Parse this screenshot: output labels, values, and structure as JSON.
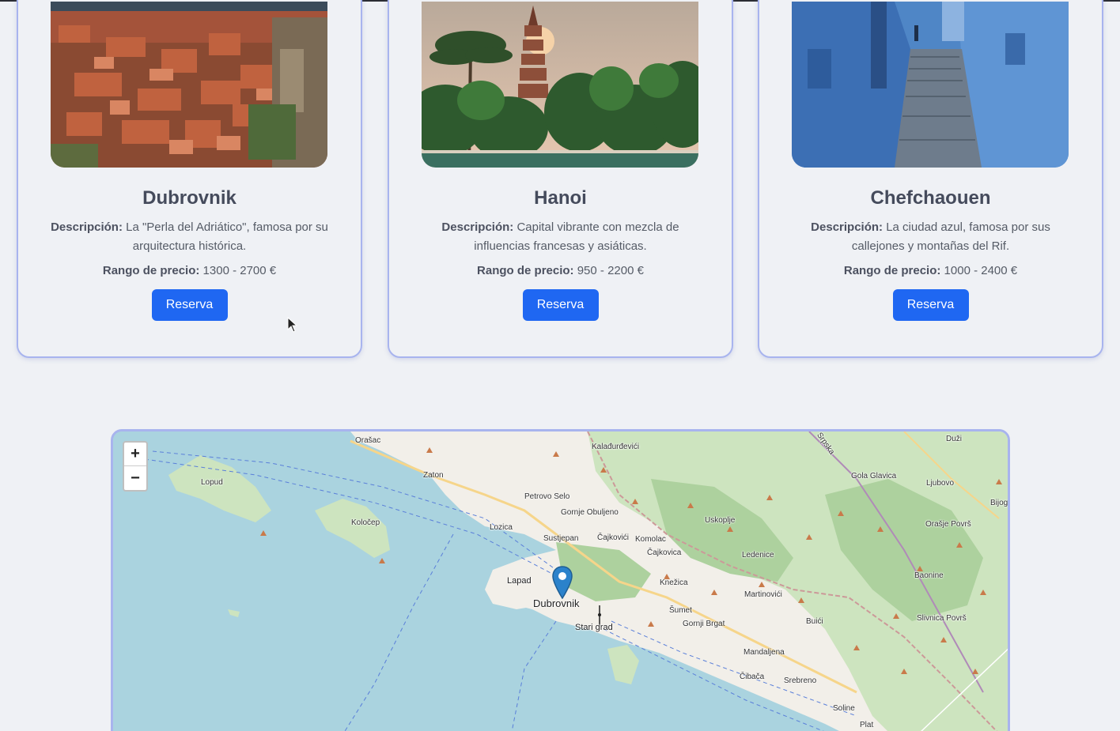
{
  "cards": [
    {
      "title": "Dubrovnik",
      "desc_label": "Descripción:",
      "desc_text": "La \"Perla del Adriático\", famosa por su arquitectura histórica.",
      "price_label": "Rango de precio:",
      "price_value": "1300 - 2700 €",
      "button": "Reserva"
    },
    {
      "title": "Hanoi",
      "desc_label": "Descripción:",
      "desc_text": "Capital vibrante con mezcla de influencias francesas y asiáticas.",
      "price_label": "Rango de precio:",
      "price_value": "950 - 2200 €",
      "button": "Reserva"
    },
    {
      "title": "Chefchaouen",
      "desc_label": "Descripción:",
      "desc_text": "La ciudad azul, famosa por sus callejones y montañas del Rif.",
      "price_label": "Rango de precio:",
      "price_value": "1000 - 2400 €",
      "button": "Reserva"
    }
  ],
  "map": {
    "zoom_in": "+",
    "zoom_out": "−",
    "places": {
      "orasac": "Orašac",
      "kaladurdevici": "Kalađurđevići",
      "srpska": "Srpska",
      "duzi": "Duži",
      "zaton": "Zaton",
      "lopud": "Lopud",
      "gola_glavica": "Gola Glavica",
      "ljubovo": "Ljubovo",
      "bijog": "Bijog",
      "petrovo_selo": "Petrovo Selo",
      "gornje_obuljeno": "Gornje Obuljeno",
      "uskoplje": "Uskoplje",
      "orasje_povrs": "Orašje Površ",
      "kolocep": "Koločep",
      "lozica": "Lozica",
      "sustjepan": "Sustjepan",
      "cajkovici": "Čajkovići",
      "komolac": "Komolac",
      "cajkovica": "Čajkovica",
      "ledenice": "Ledenice",
      "baonine": "Baonine",
      "lapad": "Lapad",
      "knezica": "Knežica",
      "martinovici": "Martinovići",
      "dubrovnik": "Dubrovnik",
      "sumet": "Šumet",
      "gornji_brgat": "Gornji Brgat",
      "buici": "Buići",
      "slivnica_povrs": "Slivnica Površ",
      "stari_grad": "Stari grad",
      "mandaljena": "Mandaljena",
      "cibaca": "Čibača",
      "srebreno": "Srebreno",
      "soline": "Soline",
      "plat": "Plat"
    }
  },
  "colors": {
    "button": "#1f67f2",
    "card_border": "#a8b4ee",
    "background": "#eff1f5",
    "sea": "#aad3df",
    "land": "#f2efe9",
    "forest": "#add19e"
  }
}
